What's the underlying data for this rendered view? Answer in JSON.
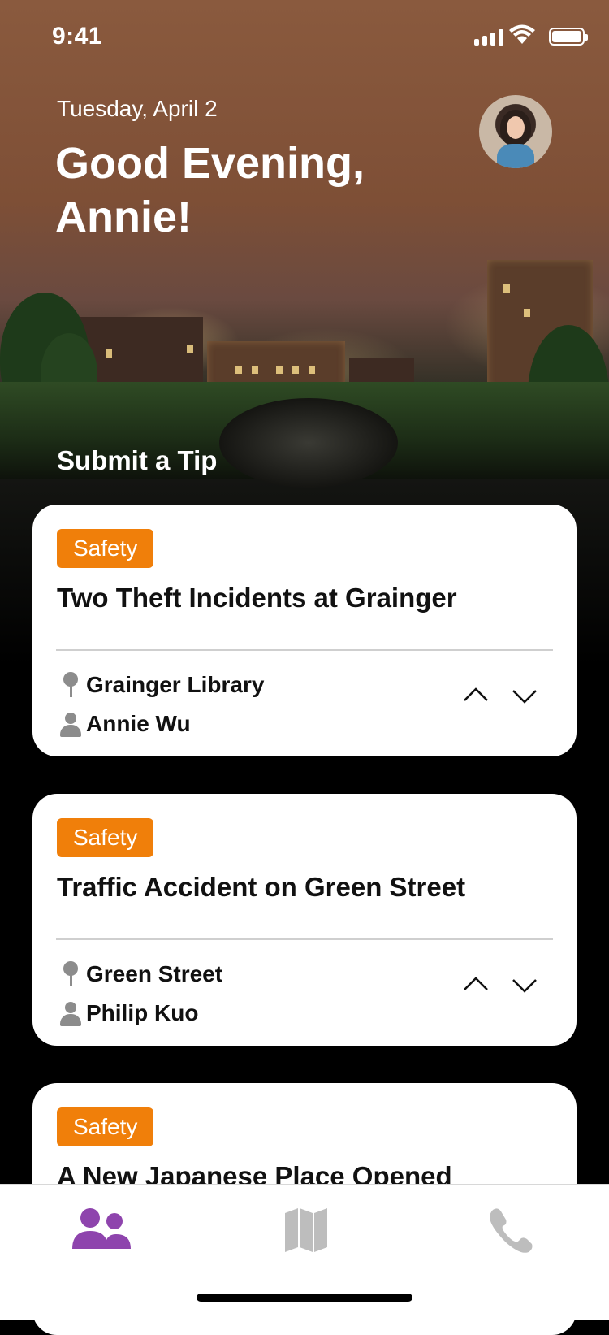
{
  "status_bar": {
    "time": "9:41"
  },
  "header": {
    "date": "Tuesday, April 2",
    "greeting": "Good Evening, Annie!"
  },
  "section": {
    "title": "Submit a Tip"
  },
  "cards": [
    {
      "tag": "Safety",
      "title": "Two Theft Incidents at Grainger",
      "location": "Grainger Library",
      "author": "Annie Wu"
    },
    {
      "tag": "Safety",
      "title": "Traffic Accident on Green Street",
      "location": "Green Street",
      "author": "Philip Kuo"
    },
    {
      "tag": "Safety",
      "title": "A New Japanese Place Opened"
    }
  ],
  "tabbar": {
    "items": [
      {
        "icon": "people-icon",
        "active": true
      },
      {
        "icon": "map-icon",
        "active": false
      },
      {
        "icon": "phone-icon",
        "active": false
      }
    ]
  },
  "colors": {
    "accent_orange": "#f07f0a",
    "active_tab_purple": "#8e44ad",
    "inactive_tab_gray": "#bdbdbd"
  }
}
